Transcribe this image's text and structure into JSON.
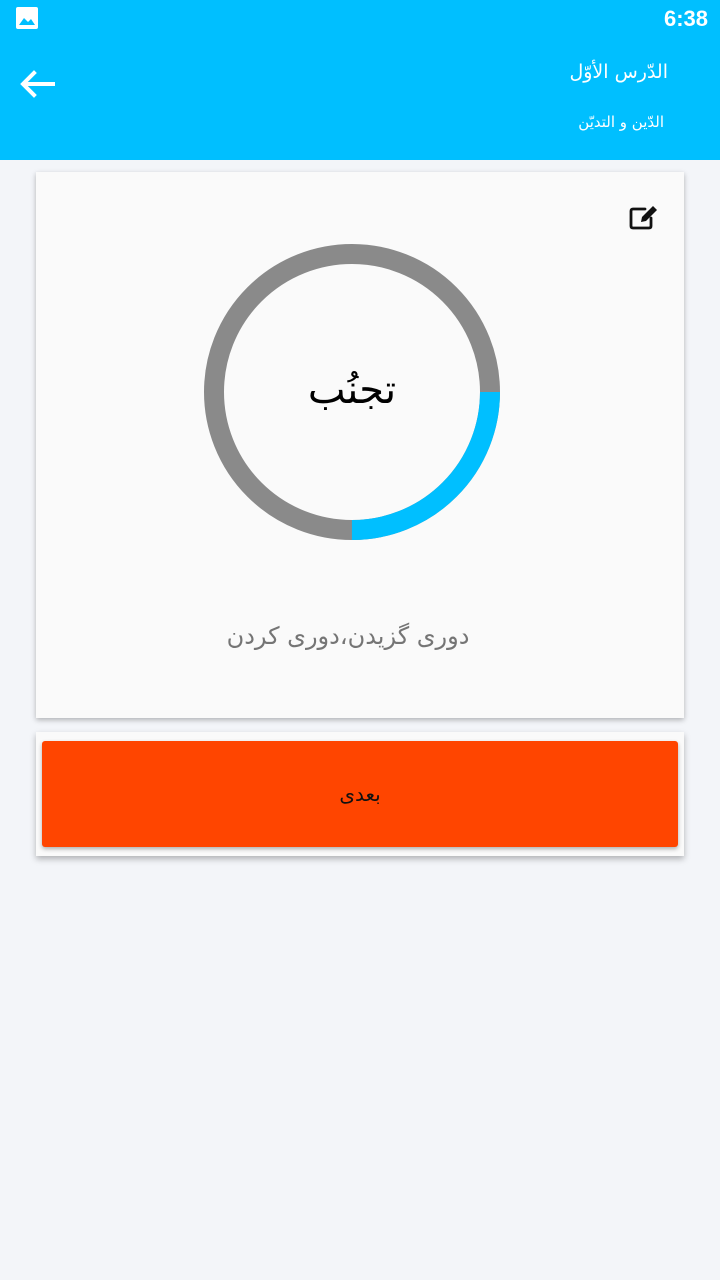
{
  "status_bar": {
    "time": "6:38",
    "icon": "image-icon"
  },
  "app_bar": {
    "back_icon": "arrow-left-icon",
    "title": "الدّرس الأوّل",
    "subtitle": "الدّين و التديّن"
  },
  "card": {
    "edit_icon": "edit-icon",
    "word": "تجنُب",
    "meaning": "دوری گزیدن،دوری کردن",
    "progress": 0.25
  },
  "actions": {
    "next_label": "بعدی"
  },
  "colors": {
    "primary": "#00bfff",
    "accent": "#ff4500",
    "ring_track": "#8a8a8a",
    "ring_progress": "#00bfff"
  }
}
